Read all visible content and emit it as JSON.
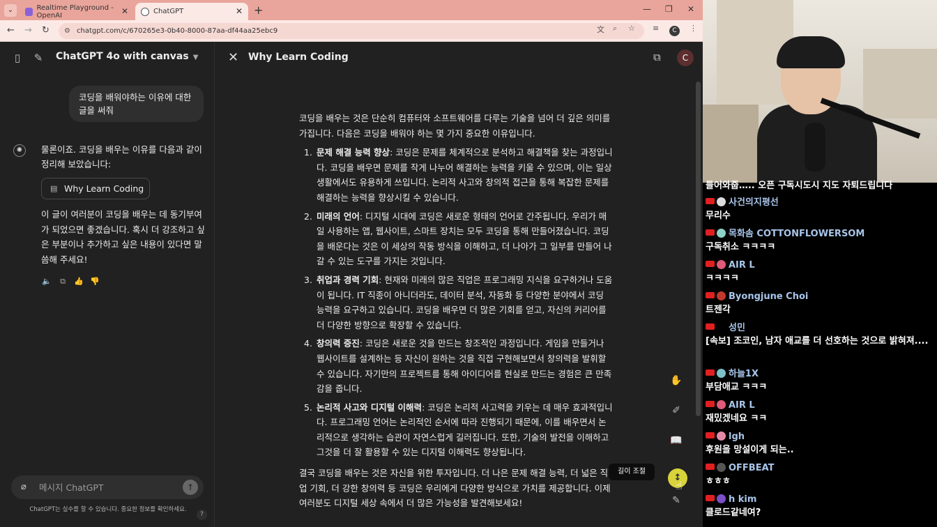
{
  "browser": {
    "tabs": [
      {
        "label": "Realtime Playground - OpenAI"
      },
      {
        "label": "ChatGPT"
      }
    ],
    "url": "chatgpt.com/c/670265e3-0b40-8000-87aa-df44aa25ebc9",
    "profile_initial": "C"
  },
  "sidebar": {
    "model_title": "ChatGPT 4o with canvas",
    "user_message": "코딩을 배워야하는 이유에 대한 글을 써줘",
    "assistant_intro": "물론이죠. 코딩을 배우는 이유를 다음과 같이 정리해 보았습니다:",
    "canvas_chip": "Why Learn Coding",
    "assistant_outro": "이 글이 여러분이 코딩을 배우는 데 동기부여가 되었으면 좋겠습니다. 혹시 더 강조하고 싶은 부분이나 추가하고 싶은 내용이 있다면 말씀해 주세요!",
    "composer_placeholder": "메시지 ChatGPT",
    "disclaimer": "ChatGPT는 실수를 할 수 있습니다. 중요한 정보를 확인하세요.",
    "help": "?"
  },
  "canvas": {
    "title": "Why Learn Coding",
    "profile_initial": "C",
    "intro": "코딩을 배우는 것은 단순히 컴퓨터와 소프트웨어를 다루는 기술을 넘어 더 깊은 의미를 가집니다. 다음은 코딩을 배워야 하는 몇 가지 중요한 이유입니다.",
    "items": [
      {
        "num": "1.",
        "title": "문제 해결 능력 향상",
        "body": ": 코딩은 문제를 체계적으로 분석하고 해결책을 찾는 과정입니다. 코딩을 배우면 문제를 작게 나누어 해결하는 능력을 키울 수 있으며, 이는 일상 생활에서도 유용하게 쓰입니다. 논리적 사고와 창의적 접근을 통해 복잡한 문제를 해결하는 능력을 향상시킬 수 있습니다."
      },
      {
        "num": "2.",
        "title": "미래의 언어",
        "body": ": 디지털 시대에 코딩은 새로운 형태의 언어로 간주됩니다. 우리가 매일 사용하는 앱, 웹사이트, 스마트 장치는 모두 코딩을 통해 만들어졌습니다. 코딩을 배운다는 것은 이 세상의 작동 방식을 이해하고, 더 나아가 그 일부를 만들어 나갈 수 있는 도구를 가지는 것입니다."
      },
      {
        "num": "3.",
        "title": "취업과 경력 기회",
        "body": ": 현재와 미래의 많은 직업은 프로그래밍 지식을 요구하거나 도움이 됩니다. IT 직종이 아니더라도, 데이터 분석, 자동화 등 다양한 분야에서 코딩 능력을 요구하고 있습니다. 코딩을 배우면 더 많은 기회를 얻고, 자신의 커리어를 더 다양한 방향으로 확장할 수 있습니다."
      },
      {
        "num": "4.",
        "title": "창의력 증진",
        "body": ": 코딩은 새로운 것을 만드는 창조적인 과정입니다. 게임을 만들거나 웹사이트를 설계하는 등 자신이 원하는 것을 직접 구현해보면서 창의력을 발휘할 수 있습니다. 자기만의 프로젝트를 통해 아이디어를 현실로 만드는 경험은 큰 만족감을 줍니다."
      },
      {
        "num": "5.",
        "title": "논리적 사고와 디지털 이해력",
        "body": ": 코딩은 논리적 사고력을 키우는 데 매우 효과적입니다. 프로그래밍 언어는 논리적인 순서에 따라 진행되기 때문에, 이를 배우면서 논리적으로 생각하는 습관이 자연스럽게 길러집니다. 또한, 기술의 발전을 이해하고 그것을 더 잘 활용할 수 있는 디지털 이해력도 향상됩니다."
      }
    ],
    "conclusion": "결국 코딩을 배우는 것은 자신을 위한 투자입니다. 더 나은 문제 해결 능력, 더 넓은 직업 기회, 더 강한 창의력 등 코딩은 우리에게 다양한 방식으로 가치를 제공합니다. 이제 여러분도 디지털 세상 속에서 더 많은 가능성을 발견해보세요!",
    "tooltip": "길이 조절"
  },
  "stream_chat": [
    {
      "name": "",
      "msg": "들어와줍….. 오픈 구독시도시 지도 자퇴드립니다",
      "color": "#a8c5ea"
    },
    {
      "name": "사건의지평선",
      "msg": "무리수",
      "color": "#a8c5ea"
    },
    {
      "name": "목화솜 COTTONFLOWERSOM",
      "msg": "구독취소 ㅋㅋㅋㅋ",
      "color": "#a8c5ea"
    },
    {
      "name": "AIR L",
      "msg": "ㅋㅋㅋㅋ",
      "color": "#a8c5ea"
    },
    {
      "name": "Byongjune Choi",
      "msg": "트젠각",
      "color": "#a8c5ea"
    },
    {
      "name": "성민",
      "msg": "[속보] 조코인, 남자 애교를 더 선호하는 것으로 밝혀져....",
      "color": "#a8c5ea"
    },
    {
      "name": "하늘1X",
      "msg": "부담애교 ㅋㅋㅋ",
      "color": "#a8c5ea"
    },
    {
      "name": "AIR L",
      "msg": "재밌겠네요 ㅋㅋ",
      "color": "#a8c5ea"
    },
    {
      "name": "lgh",
      "msg": "후원을 망설이게 되는..",
      "color": "#a8c5ea"
    },
    {
      "name": "OFFBEAT",
      "msg": "ㅎㅎㅎ",
      "color": "#a8c5ea"
    },
    {
      "name": "h kim",
      "msg": "클로드같네여?",
      "color": "#a8c5ea"
    }
  ]
}
